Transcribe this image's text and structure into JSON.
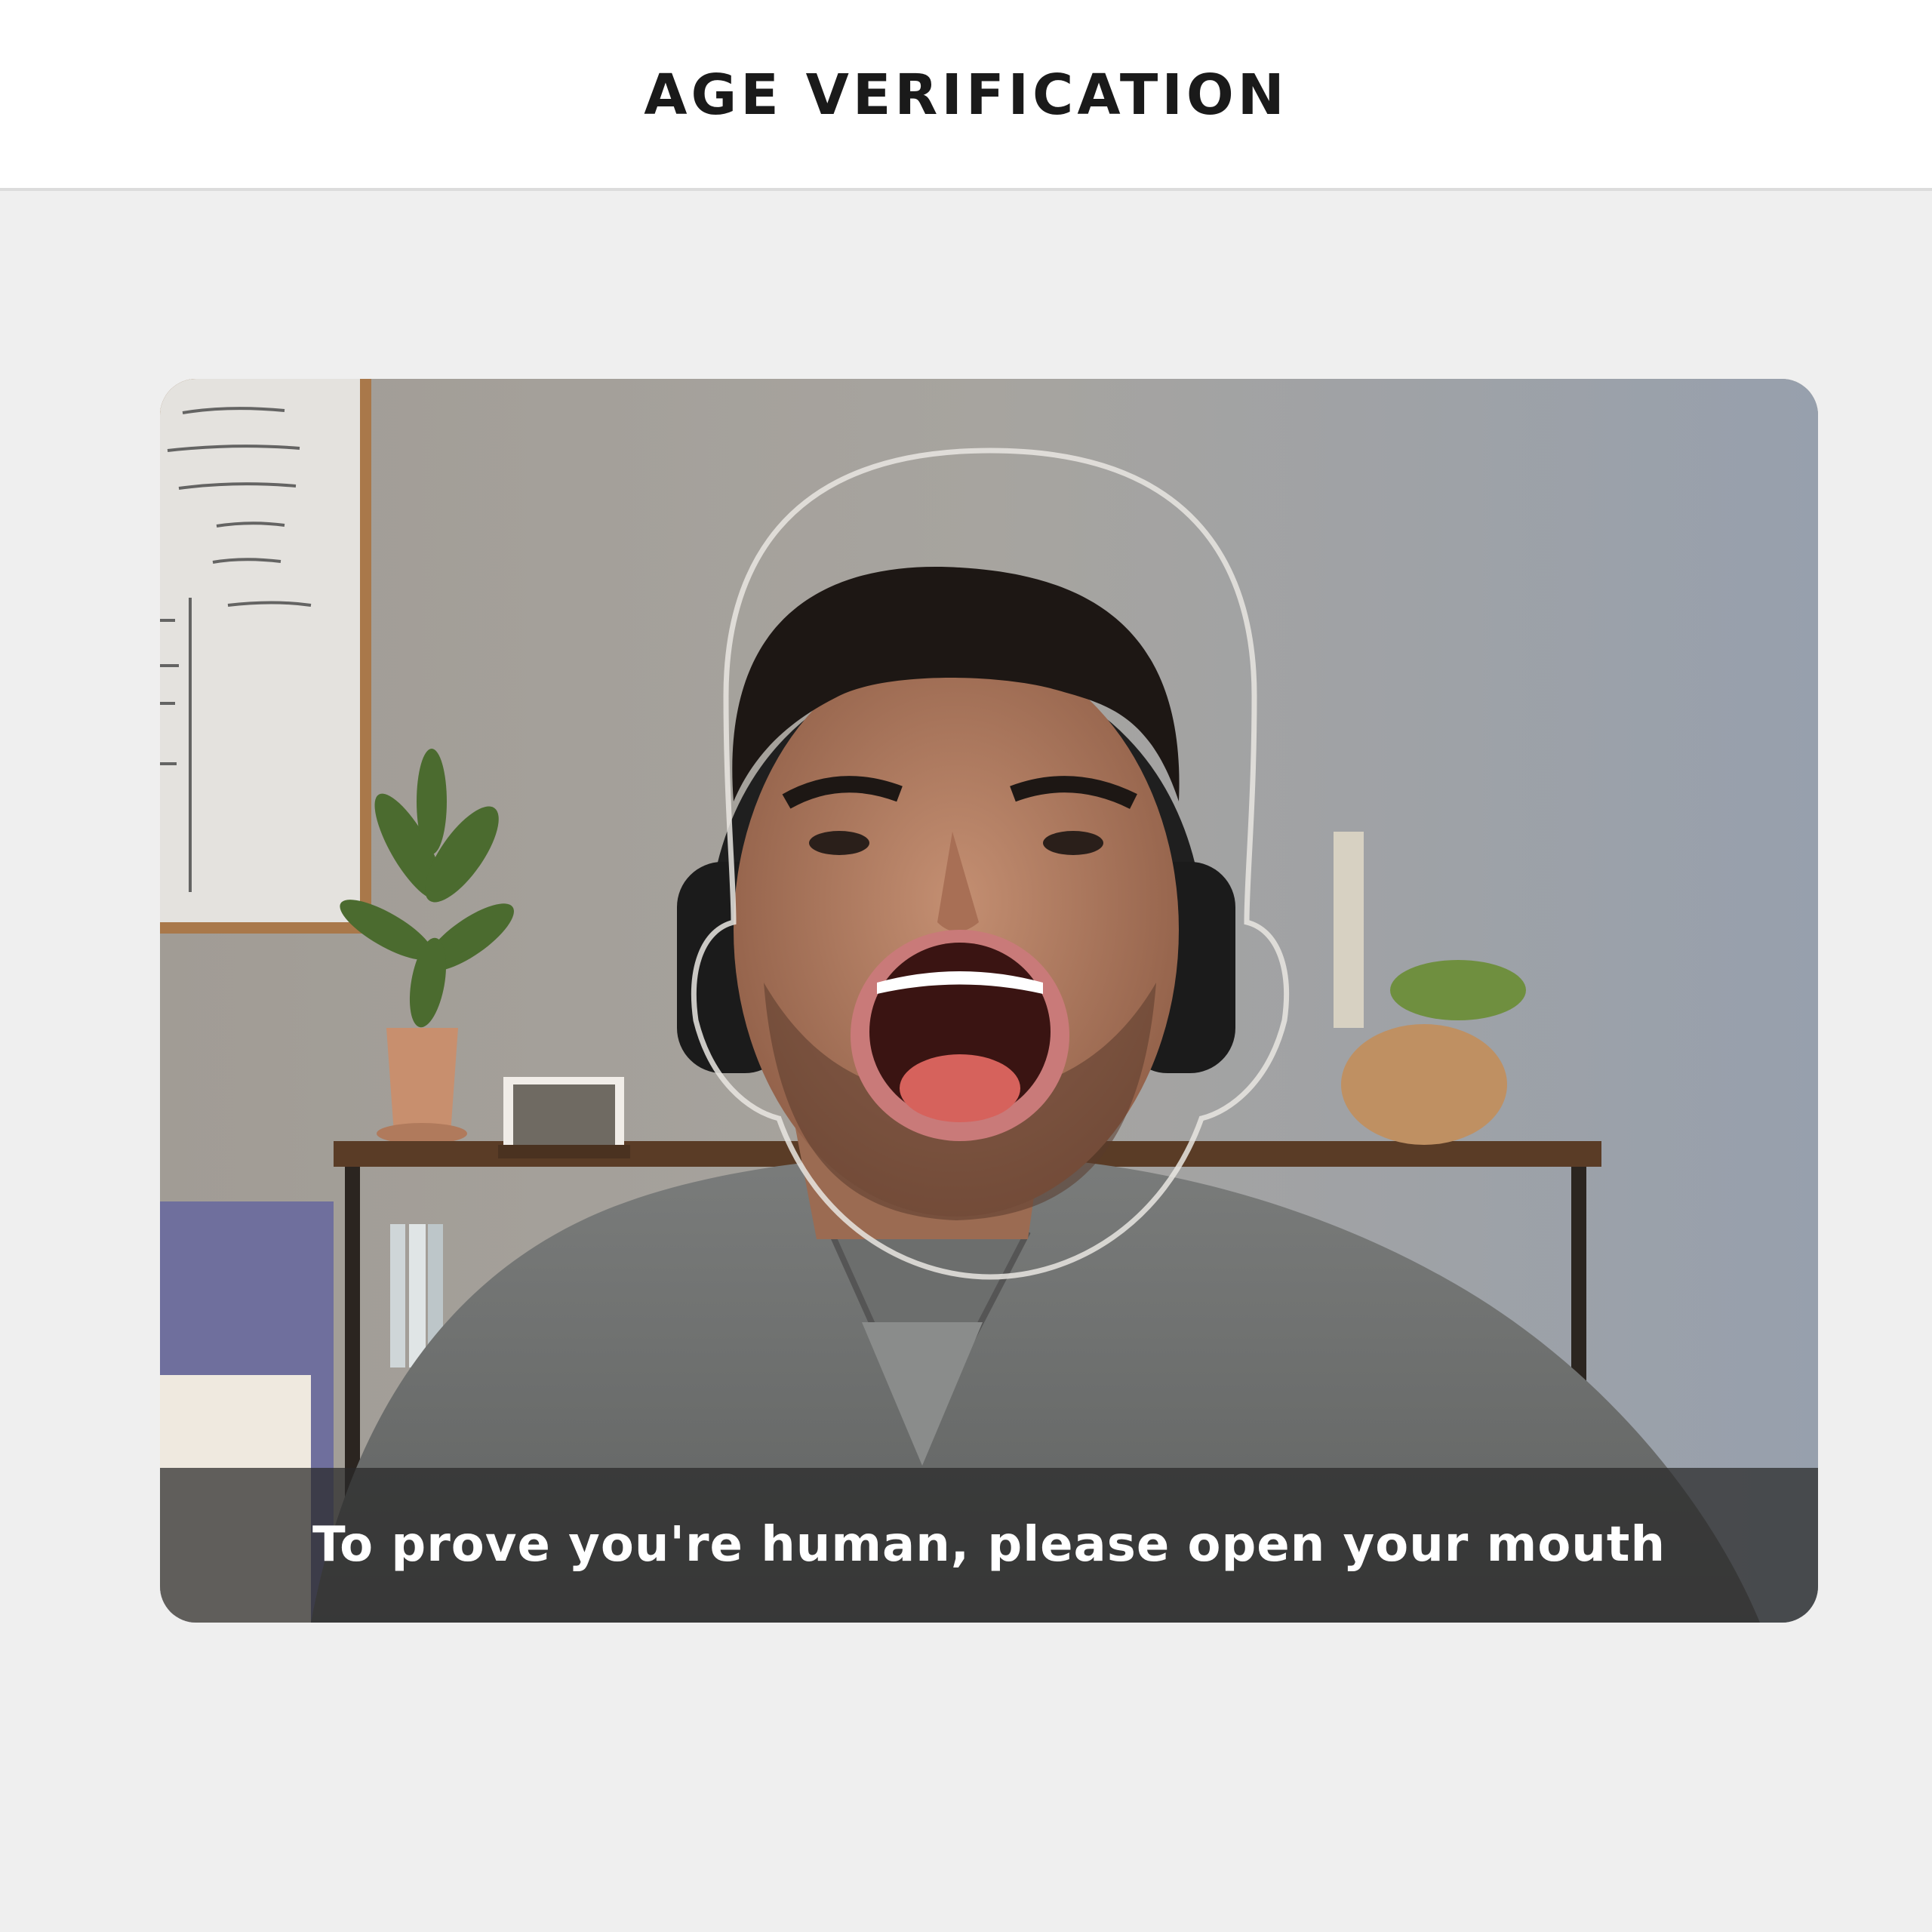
{
  "header": {
    "title": "AGE VERIFICATION"
  },
  "camera": {
    "instruction": "To prove you're human, please open your mouth",
    "overlay_icon": "face-outline-guide"
  },
  "colors": {
    "header_background": "#ffffff",
    "page_background": "#efefef",
    "title_text": "#1a1a1a",
    "caption_text": "#ffffff"
  }
}
